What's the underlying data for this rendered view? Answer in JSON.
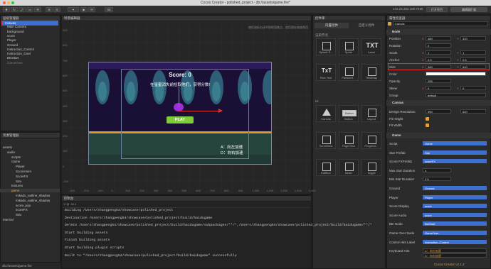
{
  "window": {
    "title": "Cocos Creator - polished_project - db://assets/game.fire*",
    "version": "Cocos Creator v2.1.2"
  },
  "toolbar": {
    "mode_3d": "3D",
    "ip": "172.24.202.180:7456",
    "btn_project": "打开项目",
    "btn_editor": "编辑器扩展"
  },
  "hierarchy": {
    "title": "层级管理器",
    "items": [
      "Canvas",
      "Main Camera",
      "background",
      "score",
      "Player",
      "Ground",
      "Instruction_Control",
      "Instruction_Goal",
      "BtnStart",
      "GameOver"
    ]
  },
  "assets": {
    "title": "资源管理器",
    "items": [
      "assets",
      "audio",
      "scripts",
      "Game",
      "Player",
      "ScoreAnim",
      "ScoreFX",
      "Star",
      "textures",
      "game",
      "mikado_outline_shadow",
      "mikado_outline_shadow",
      "score_pop",
      "scoreFX",
      "Star",
      "internal"
    ],
    "footer": "db://assets/game.fire"
  },
  "scene": {
    "title": "场景编辑器",
    "hint": "使用鼠标右键平移视窗焦点，使用滚轮缩放视图",
    "game_score": "Score: 0",
    "game_hint": "在星星消失前捡取他们，获得分数!",
    "play": "PLAY",
    "controls_a": "A：向左加速",
    "controls_d": "D：向右加速",
    "y_ticks": [
      "900",
      "800",
      "700",
      "600",
      "500",
      "400",
      "300",
      "200",
      "100",
      "0",
      "-100",
      "-200"
    ],
    "x_ticks": [
      "-300",
      "-200",
      "-100",
      "0",
      "100",
      "200",
      "300",
      "400",
      "500",
      "600",
      "700",
      "800",
      "900",
      "1,000",
      "1,100",
      "1,200",
      "1,300",
      "1,400"
    ]
  },
  "console": {
    "title": "控制台",
    "lines": [
      "Building /Users/zhangpeng54/showcase/polished_project",
      "Destination /Users/zhangpeng54/showcase/polished_project/build/baidugame",
      "Delete /Users/zhangpeng54/showcase/polished_project/build/baidugame/subpackages/**/*,/Users/zhangpeng54/showcase/polished_project/build/baidugame/**/*",
      "Start building assets",
      "Finish building assets",
      "Start building plugin scripts",
      "Built to \"/Users/zhangpeng54/showcase/polished_project/build/baidugame\" successfully"
    ]
  },
  "library": {
    "title": "控件库",
    "tabs": [
      "内置控件",
      "自定义控件"
    ],
    "sec_render": "渲染节点",
    "sec_ui": "UI",
    "render": [
      "Splash S...",
      "Sprite",
      "Label",
      "Rich Text",
      "ParticleS...",
      "TiledMap"
    ],
    "ui": [
      "Canvas",
      "Button",
      "Layout",
      "ScrollView",
      "PageView",
      "Progress...",
      "EditBox",
      "Slider",
      "Toggle"
    ],
    "btn_text": "Button",
    "label_text": "TXT",
    "rich_text": "TxT"
  },
  "inspector": {
    "title": "属性检查器",
    "node_name": "Canvas",
    "node_section": "Node",
    "props": [
      {
        "label": "Position",
        "x": "480",
        "y": "320"
      },
      {
        "label": "Rotation",
        "v": "0"
      },
      {
        "label": "Scale",
        "x": "1",
        "y": "1"
      },
      {
        "label": "Anchor",
        "x": "0.5",
        "y": "0.5"
      },
      {
        "label": "Size",
        "x": "960",
        "y": "640"
      },
      {
        "label": "Color",
        "v": ""
      },
      {
        "label": "Opacity",
        "v": "255"
      },
      {
        "label": "Skew",
        "x": "0",
        "y": "0"
      },
      {
        "label": "Group",
        "v": "default"
      }
    ],
    "canvas_section": "Canvas",
    "canvas_props": [
      {
        "label": "Design Resolution",
        "x": "960",
        "y": "640"
      },
      {
        "label": "Fit Height"
      },
      {
        "label": "Fit Width"
      }
    ],
    "game_section": "Game",
    "game_props": [
      {
        "label": "Script",
        "v": "Game"
      },
      {
        "label": "Star Prefab",
        "v": "Star"
      },
      {
        "label": "Score FXPrefab",
        "v": "scoreFX"
      },
      {
        "label": "Max Star Duration",
        "v": "4"
      },
      {
        "label": "Min Star Duration",
        "v": "2.5"
      },
      {
        "label": "Ground",
        "v": "Ground"
      },
      {
        "label": "Player",
        "v": "Player"
      },
      {
        "label": "Score Display",
        "v": "score"
      },
      {
        "label": "Score Audio",
        "v": "score"
      },
      {
        "label": "Btn Node",
        "v": "BtnStart"
      },
      {
        "label": "Game Over Node",
        "v": "GameOver"
      },
      {
        "label": "Control Hint Label",
        "v": "Instruction_Control"
      },
      {
        "label": "Keyboard Hint",
        "a": "A：向左加速",
        "d": "D：向右加速"
      }
    ],
    "tags": [
      "Game",
      "cc.Prefab",
      "cc.Prefab",
      "cc.Node",
      "cc.Node",
      "cc.Label",
      "cc.AudioClip",
      "cc.Node",
      "cc.Node",
      "cc.Label"
    ]
  },
  "colors": {
    "accent": "#3f6fcf",
    "orange": "#e8a030",
    "selection": "#e03030"
  }
}
